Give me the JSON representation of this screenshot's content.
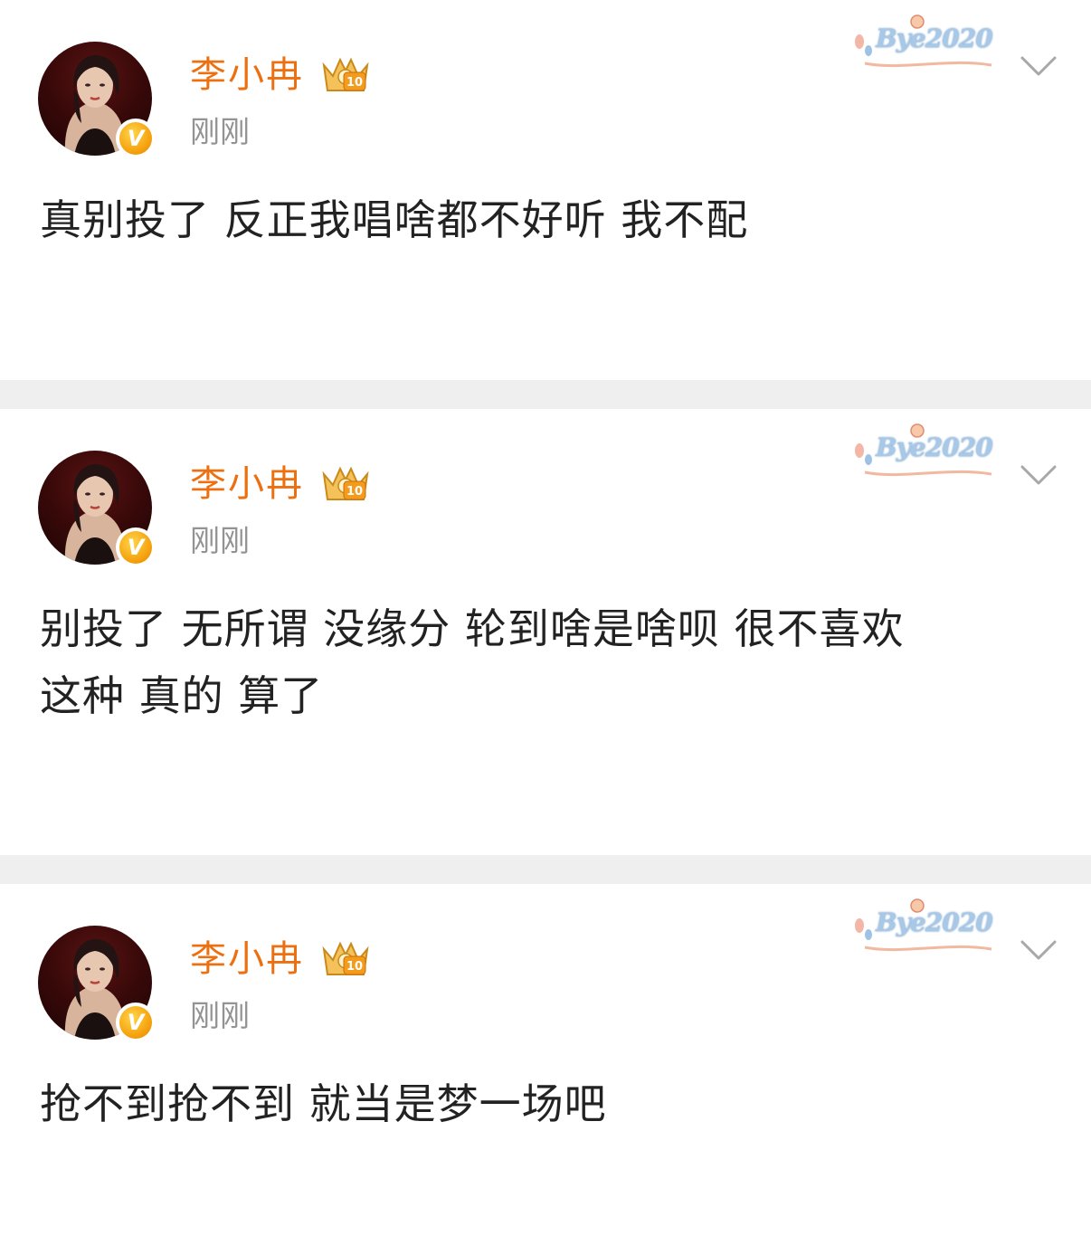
{
  "posts": [
    {
      "username": "李小冉",
      "timestamp": "刚刚",
      "level_badge": "10",
      "verified_badge": "V",
      "decoration_text": "Bye2020",
      "lines": [
        "真别投了 反正我唱啥都不好听 我不配"
      ]
    },
    {
      "username": "李小冉",
      "timestamp": "刚刚",
      "level_badge": "10",
      "verified_badge": "V",
      "decoration_text": "Bye2020",
      "lines": [
        "别投了 无所谓 没缘分 轮到啥是啥呗 很不喜欢",
        "这种 真的  算了"
      ]
    },
    {
      "username": "李小冉",
      "timestamp": "刚刚",
      "level_badge": "10",
      "verified_badge": "V",
      "decoration_text": "Bye2020",
      "lines": [
        "抢不到抢不到 就当是梦一场吧"
      ]
    }
  ],
  "colors": {
    "username": "#ec7010",
    "timestamp": "#939393",
    "content": "#222222",
    "separator": "#efefef",
    "verified_badge": "#f6a410"
  },
  "icons": {
    "verified": "verified-v-icon",
    "crown": "vip-crown-icon",
    "menu": "chevron-down-icon"
  }
}
